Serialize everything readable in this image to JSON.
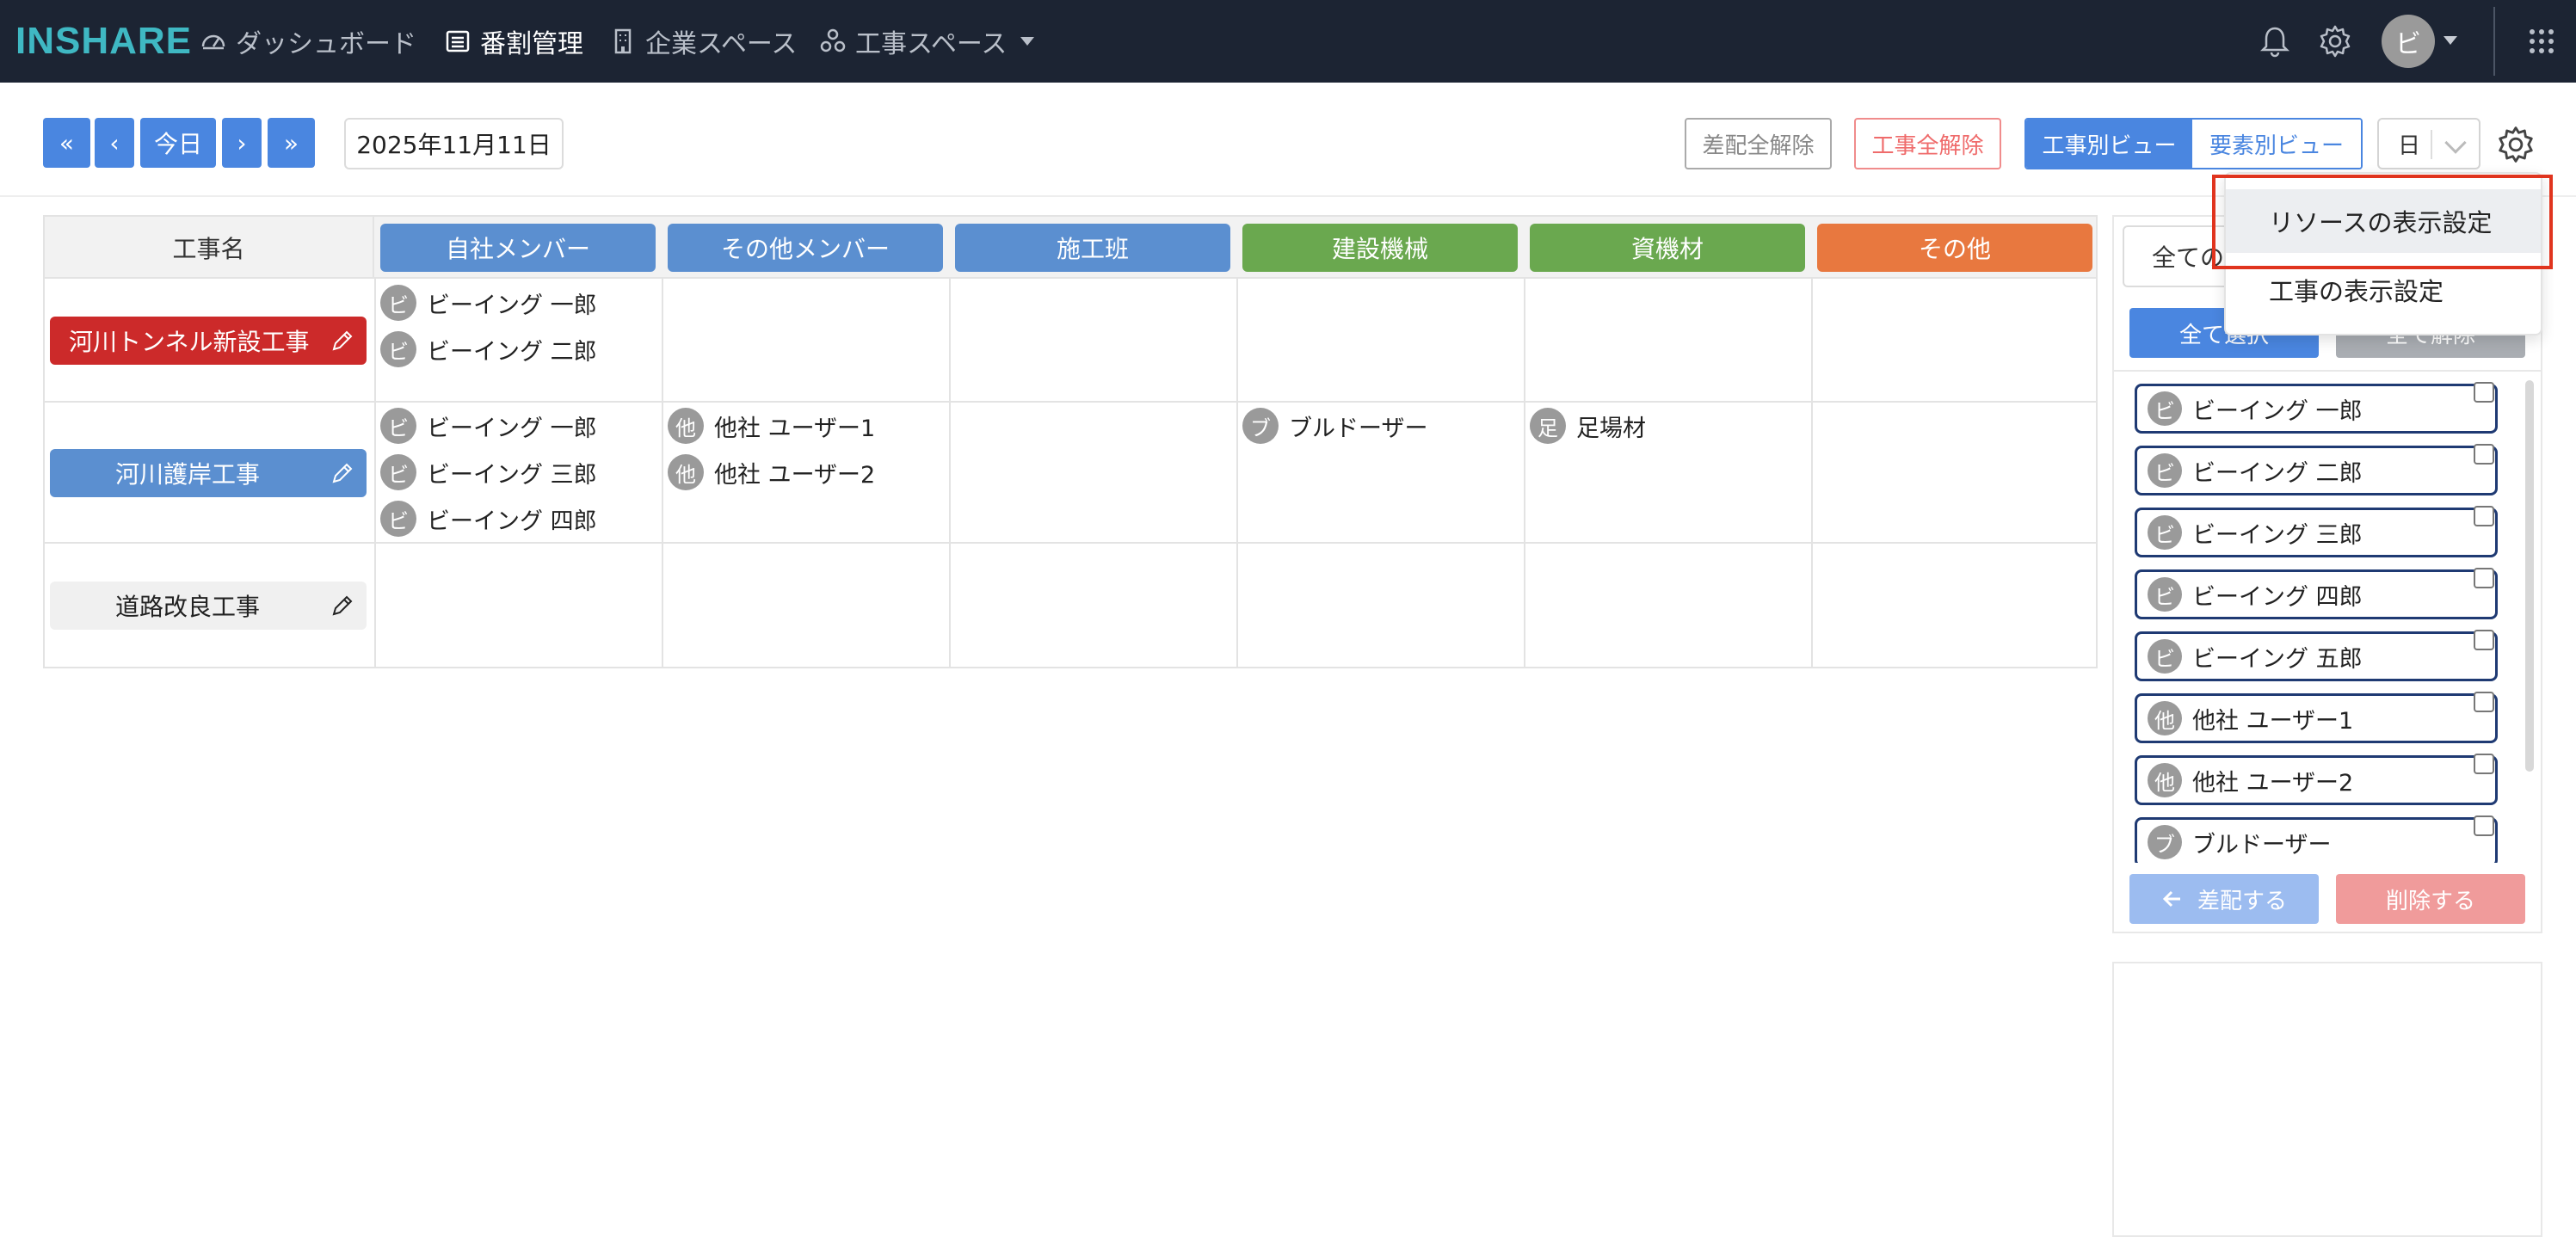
{
  "navbar": {
    "logo": "INSHARE",
    "items": [
      {
        "label": "ダッシュボード",
        "icon": "dashboard-gauge-icon"
      },
      {
        "label": "番割管理",
        "icon": "list-icon"
      },
      {
        "label": "企業スペース",
        "icon": "building-icon"
      },
      {
        "label": "工事スペース",
        "icon": "network-icon"
      }
    ],
    "user_initial": "ビ"
  },
  "toolbar": {
    "first_label": "«",
    "prev_label": "‹",
    "today_label": "今日",
    "next_label": "›",
    "last_label": "»",
    "date": "2025年11月11日",
    "clear_assign_label": "差配全解除",
    "clear_jobs_label": "工事全解除",
    "view_by_job_label": "工事別ビュー",
    "view_by_element_label": "要素別ビュー",
    "unit_value": "日"
  },
  "grid": {
    "title_column": "工事名",
    "columns": [
      {
        "label": "自社メンバー",
        "color": "#5b8fd0"
      },
      {
        "label": "その他メンバー",
        "color": "#5b8fd0"
      },
      {
        "label": "施工班",
        "color": "#5b8fd0"
      },
      {
        "label": "建設機械",
        "color": "#6aa84f"
      },
      {
        "label": "資機材",
        "color": "#6aa84f"
      },
      {
        "label": "その他",
        "color": "#e8783f"
      }
    ],
    "rows": [
      {
        "job": "河川トンネル新設工事",
        "job_color": "#cc2a2a",
        "cells": [
          [
            {
              "badge": "ビ",
              "name": "ビーイング 一郎"
            },
            {
              "badge": "ビ",
              "name": "ビーイング 二郎"
            }
          ],
          [],
          [],
          [],
          [],
          []
        ]
      },
      {
        "job": "河川護岸工事",
        "job_color": "#5b8fd0",
        "cells": [
          [
            {
              "badge": "ビ",
              "name": "ビーイング 一郎"
            },
            {
              "badge": "ビ",
              "name": "ビーイング 三郎"
            },
            {
              "badge": "ビ",
              "name": "ビーイング 四郎"
            }
          ],
          [
            {
              "badge": "他",
              "name": "他社 ユーザー1"
            },
            {
              "badge": "他",
              "name": "他社 ユーザー2"
            }
          ],
          [],
          [
            {
              "badge": "ブ",
              "name": "ブルドーザー"
            }
          ],
          [
            {
              "badge": "足",
              "name": "足場材"
            }
          ],
          []
        ]
      },
      {
        "job": "道路改良工事",
        "job_color": "#f0f0f0",
        "cells": [
          [],
          [],
          [],
          [],
          [],
          []
        ]
      }
    ]
  },
  "side_panel": {
    "filter_value": "全ての",
    "select_all_label": "全て選択",
    "deselect_all_label": "全て解除",
    "resources": [
      {
        "badge": "ビ",
        "name": "ビーイング 一郎"
      },
      {
        "badge": "ビ",
        "name": "ビーイング 二郎"
      },
      {
        "badge": "ビ",
        "name": "ビーイング 三郎"
      },
      {
        "badge": "ビ",
        "name": "ビーイング 四郎"
      },
      {
        "badge": "ビ",
        "name": "ビーイング 五郎"
      },
      {
        "badge": "他",
        "name": "他社 ユーザー1"
      },
      {
        "badge": "他",
        "name": "他社 ユーザー2"
      },
      {
        "badge": "ブ",
        "name": "ブルドーザー"
      }
    ],
    "assign_label": "差配する",
    "delete_label": "削除する"
  },
  "settings_menu": {
    "items": [
      "リソースの表示設定",
      "工事の表示設定"
    ]
  }
}
